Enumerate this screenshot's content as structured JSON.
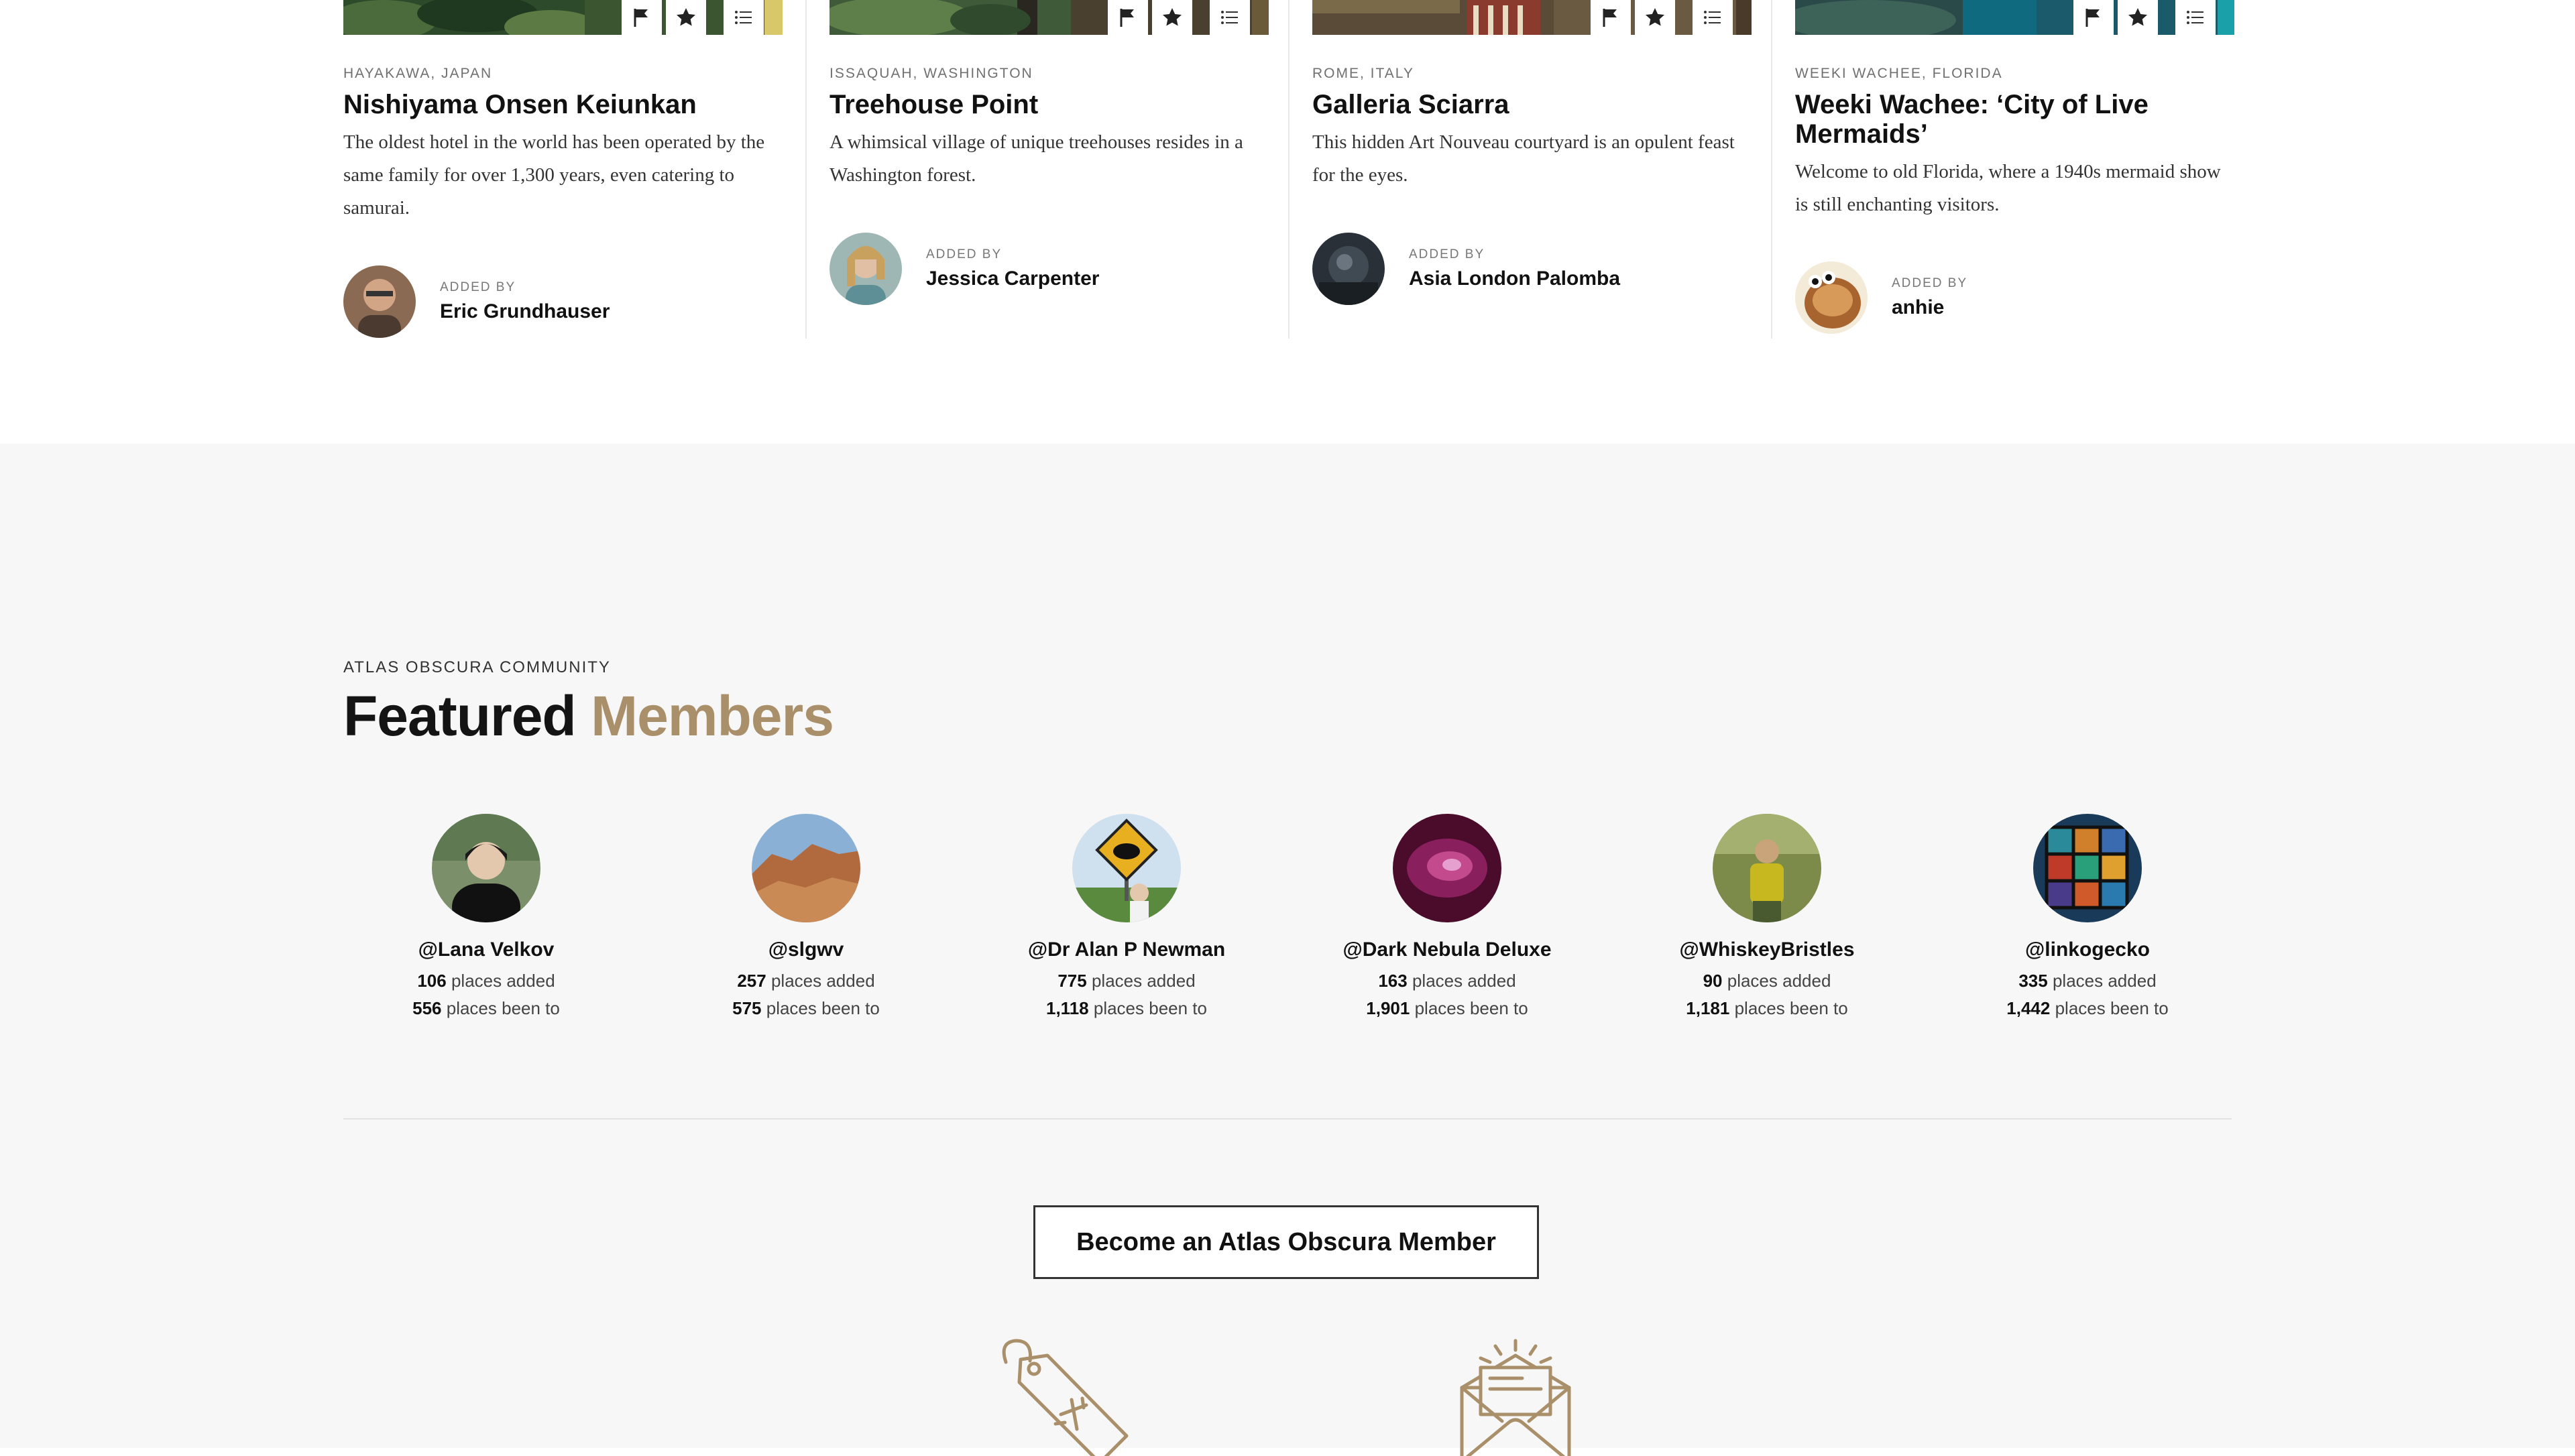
{
  "cards": [
    {
      "location": "HAYAKAWA, JAPAN",
      "title": "Nishiyama Onsen Keiunkan",
      "description": "The oldest hotel in the world has been operated by the same family for over 1,300 years, even catering to samurai.",
      "added_by_label": "ADDED BY",
      "author": "Eric Grundhauser"
    },
    {
      "location": "ISSAQUAH, WASHINGTON",
      "title": "Treehouse Point",
      "description": "A whimsical village of unique treehouses resides in a Washington forest.",
      "added_by_label": "ADDED BY",
      "author": "Jessica Carpenter"
    },
    {
      "location": "ROME, ITALY",
      "title": "Galleria Sciarra",
      "description": "This hidden Art Nouveau courtyard is an opulent feast for the eyes.",
      "added_by_label": "ADDED BY",
      "author": "Asia London Palomba"
    },
    {
      "location": "WEEKI WACHEE, FLORIDA",
      "title": "Weeki Wachee: ‘City of Live Mermaids’",
      "description": "Welcome to old Florida, where a 1940s mermaid show is still enchanting visitors.",
      "added_by_label": "ADDED BY",
      "author": "anhie"
    }
  ],
  "community": {
    "eyebrow": "ATLAS OBSCURA COMMUNITY",
    "heading_1": "Featured",
    "heading_2": "Members",
    "accent_color": "#a98f6a",
    "places_added_label": "places added",
    "places_been_label": "places been to",
    "members": [
      {
        "handle": "@Lana Velkov",
        "added": "106",
        "been": "556"
      },
      {
        "handle": "@slgwv",
        "added": "257",
        "been": "575"
      },
      {
        "handle": "@Dr Alan P Newman",
        "added": "775",
        "been": "1,118"
      },
      {
        "handle": "@Dark Nebula Deluxe",
        "added": "163",
        "been": "1,901"
      },
      {
        "handle": "@WhiskeyBristles",
        "added": "90",
        "been": "1,181"
      },
      {
        "handle": "@linkogecko",
        "added": "335",
        "been": "1,442"
      }
    ],
    "cta_label": "Become an Atlas Obscura Member"
  },
  "icons": {
    "card_actions": [
      "flag-icon",
      "star-icon",
      "list-icon"
    ],
    "benefits": [
      "travel-tag-icon",
      "newsletter-mail-icon"
    ]
  }
}
